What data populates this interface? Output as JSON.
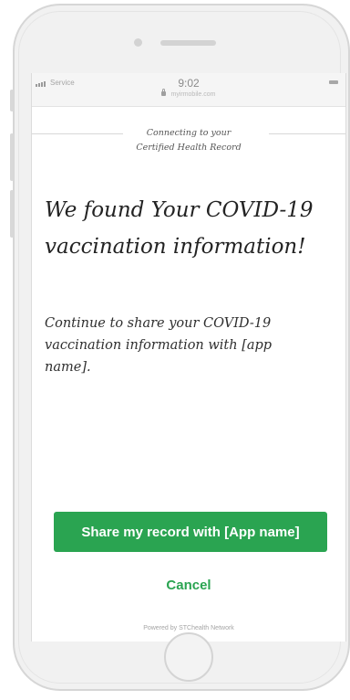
{
  "status_bar": {
    "carrier": "Service",
    "time": "9:02",
    "url": "myirmobile.com"
  },
  "header": {
    "line1": "Connecting to your",
    "line2": "Certified Health Record"
  },
  "main": {
    "headline": "We found Your COVID-19 vaccination information!",
    "body": "Continue to share your COVID-19 vaccination information with [app name]."
  },
  "actions": {
    "share_label": "Share my record with [App name]",
    "cancel_label": "Cancel"
  },
  "footer": {
    "powered_by": "Powered by STChealth Network"
  },
  "colors": {
    "accent": "#2aa451",
    "text": "#232323"
  },
  "icons": [
    "signal-bars-icon",
    "lock-icon",
    "battery-icon"
  ]
}
